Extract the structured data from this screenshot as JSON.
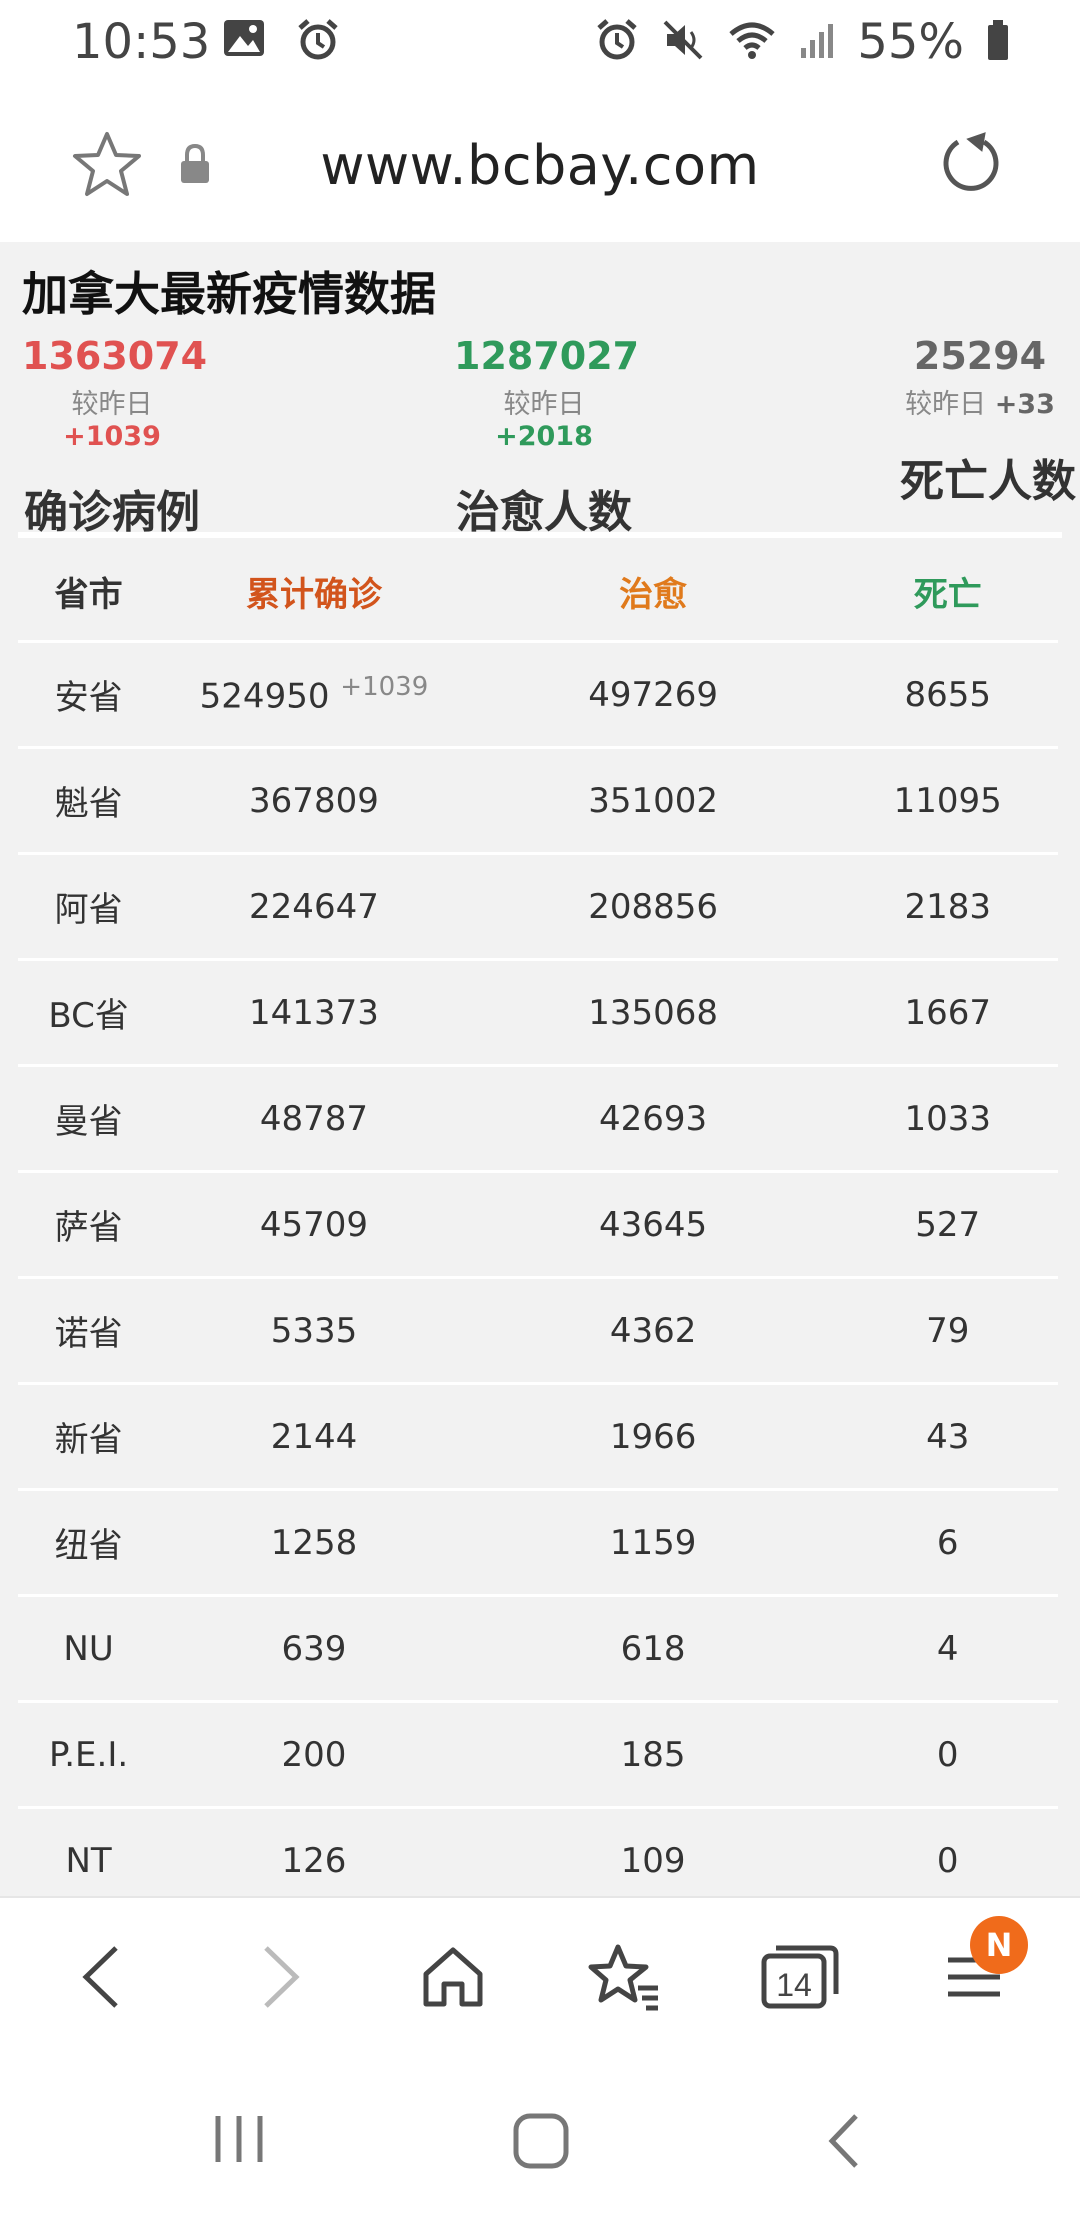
{
  "status_bar": {
    "time": "10:53",
    "battery": "55%",
    "icons": [
      "image-icon",
      "alarm-icon",
      "alarm-icon",
      "mute-icon",
      "wifi-icon",
      "signal-icon",
      "battery-icon"
    ]
  },
  "url_bar": {
    "url": "www.bcbay.com",
    "icons": [
      "star-icon",
      "lock-icon",
      "reload-icon"
    ]
  },
  "page": {
    "title": "加拿大最新疫情数据",
    "summary": {
      "confirmed": {
        "value": "1363074",
        "delta_prefix": "较昨日",
        "delta": "+1039",
        "label": "确诊病例",
        "color": "#e05251"
      },
      "recovered": {
        "value": "1287027",
        "delta_prefix": "较昨日",
        "delta": "+2018",
        "label": "治愈人数",
        "color": "#2f9a5b"
      },
      "deaths": {
        "value": "25294",
        "delta_prefix": "较昨日",
        "delta": "+33",
        "label": "死亡人数",
        "color": "#666666"
      }
    },
    "table": {
      "headers": [
        "省市",
        "累计确诊",
        "治愈",
        "死亡"
      ],
      "rows": [
        {
          "province": "安省",
          "confirmed": "524950",
          "increase": "+1039",
          "recovered": "497269",
          "deaths": "8655"
        },
        {
          "province": "魁省",
          "confirmed": "367809",
          "increase": "",
          "recovered": "351002",
          "deaths": "11095"
        },
        {
          "province": "阿省",
          "confirmed": "224647",
          "increase": "",
          "recovered": "208856",
          "deaths": "2183"
        },
        {
          "province": "BC省",
          "confirmed": "141373",
          "increase": "",
          "recovered": "135068",
          "deaths": "1667"
        },
        {
          "province": "曼省",
          "confirmed": "48787",
          "increase": "",
          "recovered": "42693",
          "deaths": "1033"
        },
        {
          "province": "萨省",
          "confirmed": "45709",
          "increase": "",
          "recovered": "43645",
          "deaths": "527"
        },
        {
          "province": "诺省",
          "confirmed": "5335",
          "increase": "",
          "recovered": "4362",
          "deaths": "79"
        },
        {
          "province": "新省",
          "confirmed": "2144",
          "increase": "",
          "recovered": "1966",
          "deaths": "43"
        },
        {
          "province": "纽省",
          "confirmed": "1258",
          "increase": "",
          "recovered": "1159",
          "deaths": "6"
        },
        {
          "province": "NU",
          "confirmed": "639",
          "increase": "",
          "recovered": "618",
          "deaths": "4"
        },
        {
          "province": "P.E.I.",
          "confirmed": "200",
          "increase": "",
          "recovered": "185",
          "deaths": "0"
        },
        {
          "province": "NT",
          "confirmed": "126",
          "increase": "",
          "recovered": "109",
          "deaths": "0"
        }
      ]
    }
  },
  "browser_nav": {
    "tabs_count": "14",
    "menu_badge": "N",
    "icons": [
      "back-icon",
      "forward-icon",
      "home-icon",
      "bookmarks-icon",
      "tabs-icon",
      "menu-icon"
    ]
  },
  "system_nav": {
    "icons": [
      "recent-apps-icon",
      "home-button-icon",
      "system-back-icon"
    ]
  }
}
